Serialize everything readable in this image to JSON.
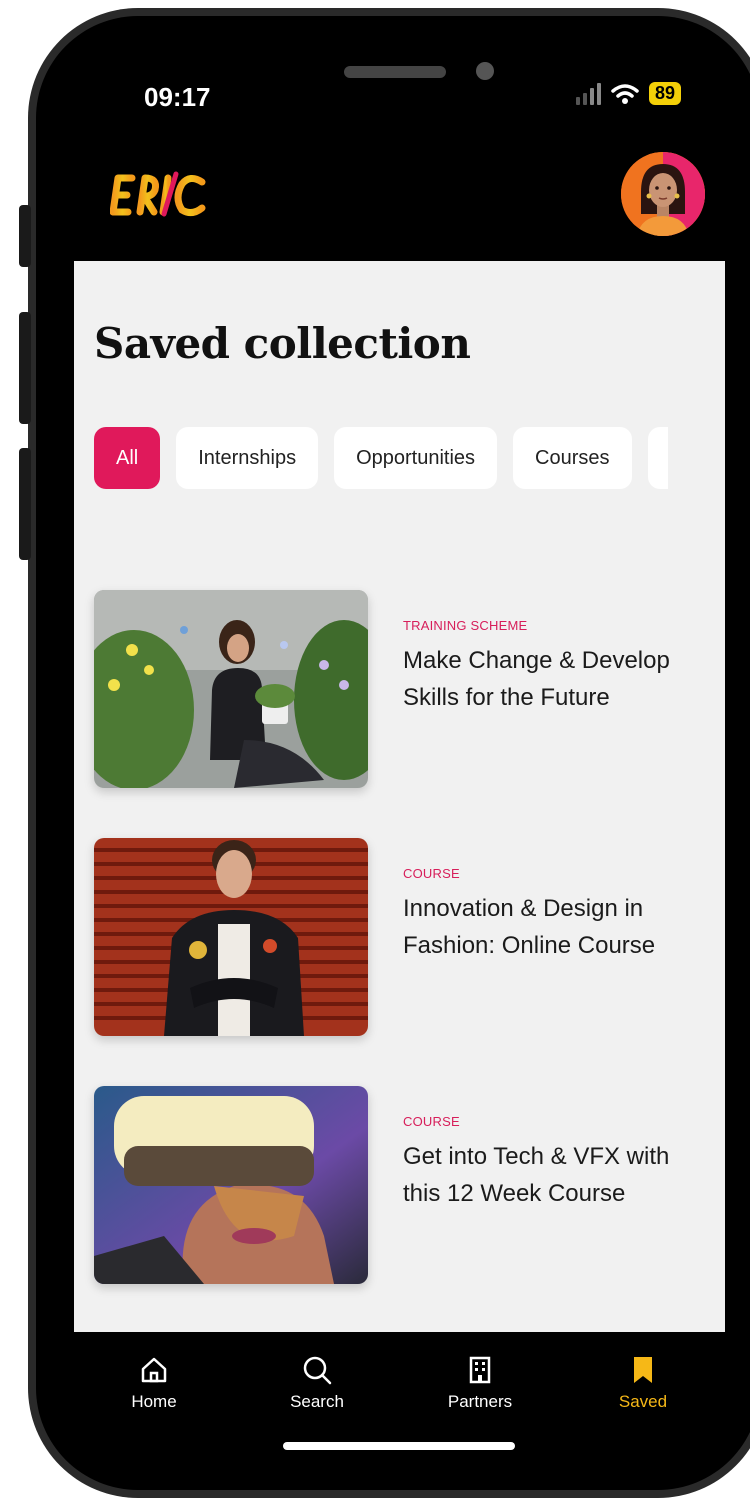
{
  "status_bar": {
    "time": "09:17",
    "battery": "89"
  },
  "header": {
    "logo": "ERIC"
  },
  "page": {
    "title": "Saved collection"
  },
  "filters": [
    {
      "label": "All",
      "active": true
    },
    {
      "label": "Internships",
      "active": false
    },
    {
      "label": "Opportunities",
      "active": false
    },
    {
      "label": "Courses",
      "active": false
    }
  ],
  "items": [
    {
      "category": "TRAINING SCHEME",
      "title": "Make Change & Develop Skills for the Future"
    },
    {
      "category": "COURSE",
      "title": "Innovation & Design in Fashion: Online Course"
    },
    {
      "category": "COURSE",
      "title": "Get into Tech & VFX with this 12 Week Course"
    }
  ],
  "tabbar": {
    "tabs": [
      {
        "label": "Home",
        "icon": "home-icon"
      },
      {
        "label": "Search",
        "icon": "search-icon"
      },
      {
        "label": "Partners",
        "icon": "building-icon"
      },
      {
        "label": "Saved",
        "icon": "bookmark-icon",
        "active": true
      }
    ]
  },
  "colors": {
    "accent": "#e0195b",
    "active_tab": "#f6b817",
    "category": "#d71e5a",
    "background": "#f1f1f1"
  }
}
